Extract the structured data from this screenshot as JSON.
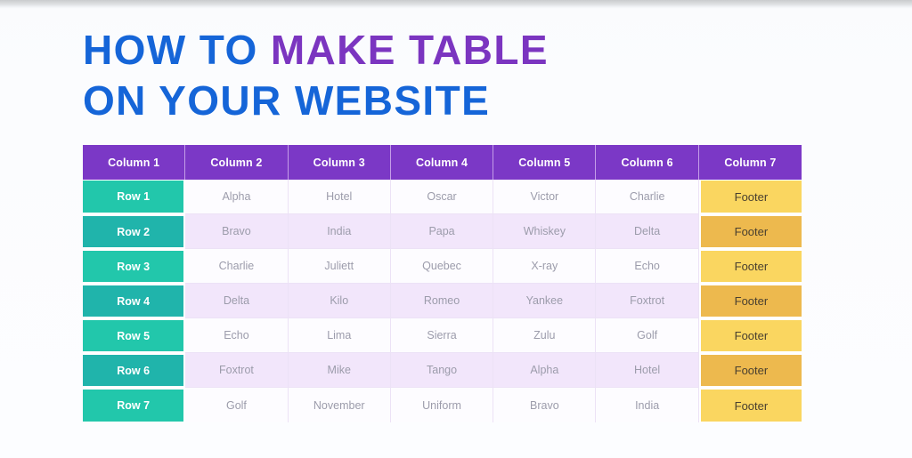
{
  "title": {
    "line1_part1": "HOW TO ",
    "line1_part2": "MAKE TABLE",
    "line2": "ON YOUR WEBSITE"
  },
  "colors": {
    "title_blue": "#1565d8",
    "title_purple": "#7b35c0",
    "header_purple": "#7b38c6",
    "rowlabel_teal_light": "#22c7ab",
    "rowlabel_teal_dark": "#20b4ab",
    "footer_yellow_light": "#fad660",
    "footer_yellow_dark": "#edb94e",
    "row_even_lavender": "#f2e6fb",
    "row_odd_white": "#fdfcff",
    "body_text_grey": "#9c9cab",
    "page_background": "#fbfcfe"
  },
  "table": {
    "headers": [
      "Column 1",
      "Column 2",
      "Column 3",
      "Column 4",
      "Column 5",
      "Column 6",
      "Column 7"
    ],
    "rows": [
      [
        "Row 1",
        "Alpha",
        "Hotel",
        "Oscar",
        "Victor",
        "Charlie",
        "Footer"
      ],
      [
        "Row 2",
        "Bravo",
        "India",
        "Papa",
        "Whiskey",
        "Delta",
        "Footer"
      ],
      [
        "Row 3",
        "Charlie",
        "Juliett",
        "Quebec",
        "X-ray",
        "Echo",
        "Footer"
      ],
      [
        "Row 4",
        "Delta",
        "Kilo",
        "Romeo",
        "Yankee",
        "Foxtrot",
        "Footer"
      ],
      [
        "Row 5",
        "Echo",
        "Lima",
        "Sierra",
        "Zulu",
        "Golf",
        "Footer"
      ],
      [
        "Row 6",
        "Foxtrot",
        "Mike",
        "Tango",
        "Alpha",
        "Hotel",
        "Footer"
      ],
      [
        "Row 7",
        "Golf",
        "November",
        "Uniform",
        "Bravo",
        "India",
        "Footer"
      ]
    ]
  }
}
